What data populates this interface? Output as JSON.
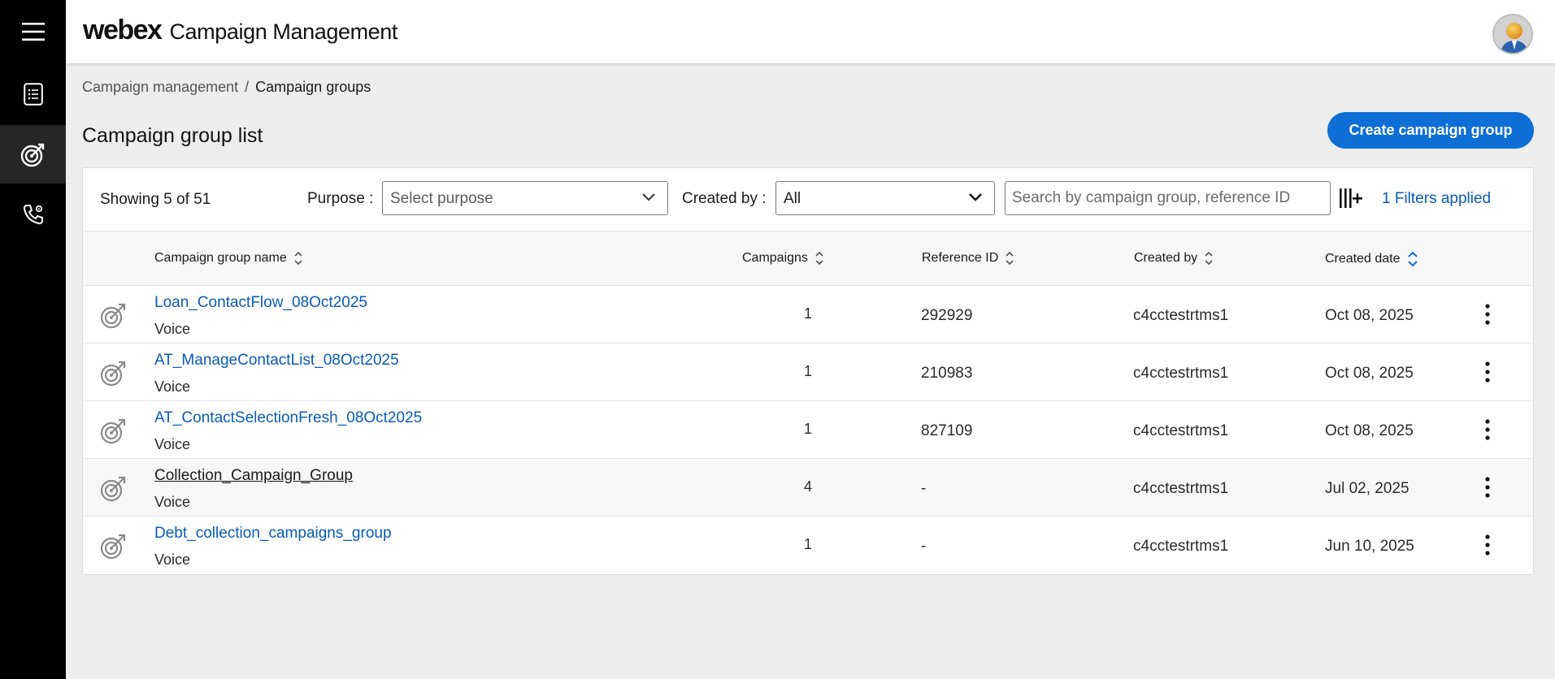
{
  "app": {
    "brand": "webex",
    "title": "Campaign Management"
  },
  "nav": {
    "items": [
      {
        "icon": "menu-icon"
      },
      {
        "icon": "list-icon"
      },
      {
        "icon": "target-icon",
        "active": true
      },
      {
        "icon": "phone-settings-icon"
      }
    ]
  },
  "breadcrumb": {
    "parent": "Campaign management",
    "separator": "/",
    "current": "Campaign groups"
  },
  "page": {
    "title": "Campaign group list",
    "create_button": "Create campaign group"
  },
  "toolbar": {
    "showing": "Showing 5 of 51",
    "purpose_label": "Purpose :",
    "purpose_value": "Select purpose",
    "created_by_label": "Created by :",
    "created_by_value": "All",
    "search_placeholder": "Search by campaign group, reference ID",
    "filters_applied": "1 Filters applied"
  },
  "table": {
    "columns": {
      "name": "Campaign group name",
      "campaigns": "Campaigns",
      "reference_id": "Reference ID",
      "created_by": "Created by",
      "created_date": "Created date"
    },
    "rows": [
      {
        "name": "Loan_ContactFlow_08Oct2025",
        "type": "Voice",
        "campaigns": "1",
        "reference_id": "292929",
        "created_by": "c4cctestrtms1",
        "created_date": "Oct 08, 2025"
      },
      {
        "name": "AT_ManageContactList_08Oct2025",
        "type": "Voice",
        "campaigns": "1",
        "reference_id": "210983",
        "created_by": "c4cctestrtms1",
        "created_date": "Oct 08, 2025"
      },
      {
        "name": "AT_ContactSelectionFresh_08Oct2025",
        "type": "Voice",
        "campaigns": "1",
        "reference_id": "827109",
        "created_by": "c4cctestrtms1",
        "created_date": "Oct 08, 2025"
      },
      {
        "name": "Collection_Campaign_Group",
        "type": "Voice",
        "campaigns": "4",
        "reference_id": "-",
        "created_by": "c4cctestrtms1",
        "created_date": "Jul 02, 2025"
      },
      {
        "name": "Debt_collection_campaigns_group",
        "type": "Voice",
        "campaigns": "1",
        "reference_id": "-",
        "created_by": "c4cctestrtms1",
        "created_date": "Jun 10, 2025"
      }
    ]
  },
  "colors": {
    "primary": "#0d6ed6",
    "link": "#0a5bb5",
    "rail": "#000000"
  }
}
